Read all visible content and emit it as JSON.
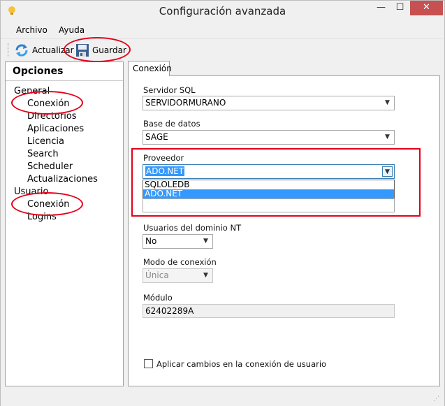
{
  "window": {
    "title": "Configuración avanzada",
    "controls": {
      "minimize": "—",
      "maximize": "☐",
      "close": "✕"
    }
  },
  "menu": {
    "items": [
      {
        "label": "Archivo"
      },
      {
        "label": "Ayuda"
      }
    ]
  },
  "toolbar": {
    "refresh_label": "Actualizar",
    "save_label": "Guardar"
  },
  "left_panel": {
    "header": "Opciones",
    "groups": [
      {
        "label": "General",
        "items": [
          "Conexión",
          "Directorios",
          "Aplicaciones",
          "Licencia",
          "Search",
          "Scheduler",
          "Actualizaciones"
        ]
      },
      {
        "label": "Usuario",
        "items": [
          "Conexión",
          "Logins"
        ]
      }
    ]
  },
  "tab": {
    "label": "Conexión"
  },
  "form": {
    "servidor_label": "Servidor SQL",
    "servidor_value": "SERVIDORMURANO",
    "base_label": "Base de datos",
    "base_value": "SAGE",
    "proveedor_label": "Proveedor",
    "proveedor_value": "ADO.NET",
    "proveedor_options": [
      "SQLOLEDB",
      "ADO.NET"
    ],
    "usuarios_label": "Usuarios del dominio NT",
    "usuarios_value": "No",
    "modo_label": "Modo de conexión",
    "modo_value": "Única",
    "modulo_label": "Módulo",
    "modulo_value": "62402289A",
    "apply_label": "Aplicar cambios en la conexión de usuario"
  },
  "colors": {
    "annotation": "#e4001a",
    "selection": "#3399ff",
    "close_button": "#c75050"
  },
  "icons": {
    "app": "lightbulb-icon",
    "refresh": "refresh-icon",
    "save": "floppy-disk-icon"
  }
}
